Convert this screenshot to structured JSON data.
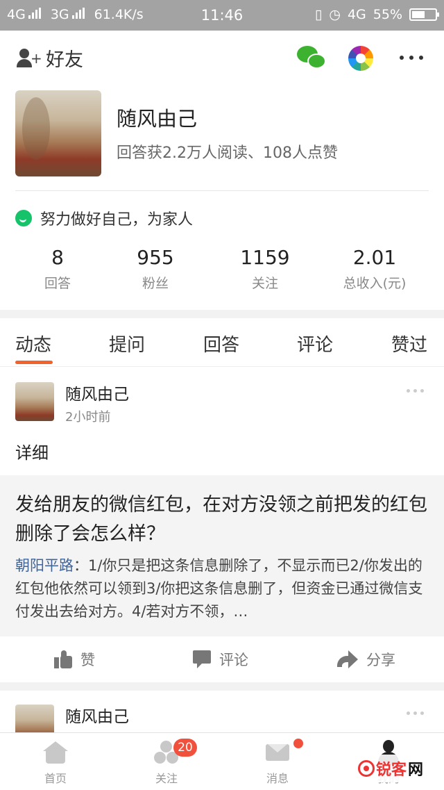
{
  "status_bar": {
    "network1": "4G",
    "network2": "3G",
    "speed": "61.4K/s",
    "time": "11:46",
    "network3": "4G",
    "battery": "55%"
  },
  "header": {
    "add_friend_label": "好友",
    "username": "随风由己",
    "stats_line": "回答获2.2万人阅读、108人点赞",
    "motto": "努力做好自己，为家人",
    "counters": [
      {
        "value": "8",
        "label": "回答"
      },
      {
        "value": "955",
        "label": "粉丝"
      },
      {
        "value": "1159",
        "label": "关注"
      },
      {
        "value": "2.01",
        "label": "总收入(元)"
      }
    ]
  },
  "tabs": [
    "动态",
    "提问",
    "回答",
    "评论",
    "赞过"
  ],
  "active_tab": "动态",
  "feed": {
    "card1": {
      "author": "随风由己",
      "time": "2小时前",
      "detail_label": "详细",
      "question": "发给朋友的微信红包，在对方没领之前把发的红包删除了会怎么样？",
      "answer_author": "朝阳平路",
      "answer_text": "：1/你只是把这条信息删除了，不显示而已2/你发出的红包他依然可以领到3/你把这条信息删了，但资金已通过微信支付发出去给对方。4/若对方不领，…",
      "actions": {
        "like": "赞",
        "comment": "评论",
        "share": "分享"
      }
    },
    "card2": {
      "author": "随风由己"
    }
  },
  "bottom_nav": {
    "items": [
      {
        "label": "首页"
      },
      {
        "label": "关注"
      },
      {
        "label": "消息"
      },
      {
        "label": "我的"
      }
    ],
    "follow_badge": "20"
  },
  "watermark": {
    "text1": "锐客",
    "text2": "网"
  },
  "colors": {
    "accent": "#f0632e",
    "badge": "#f0503c",
    "link": "#406599",
    "status_bar_bg": "#a3a3a3"
  }
}
